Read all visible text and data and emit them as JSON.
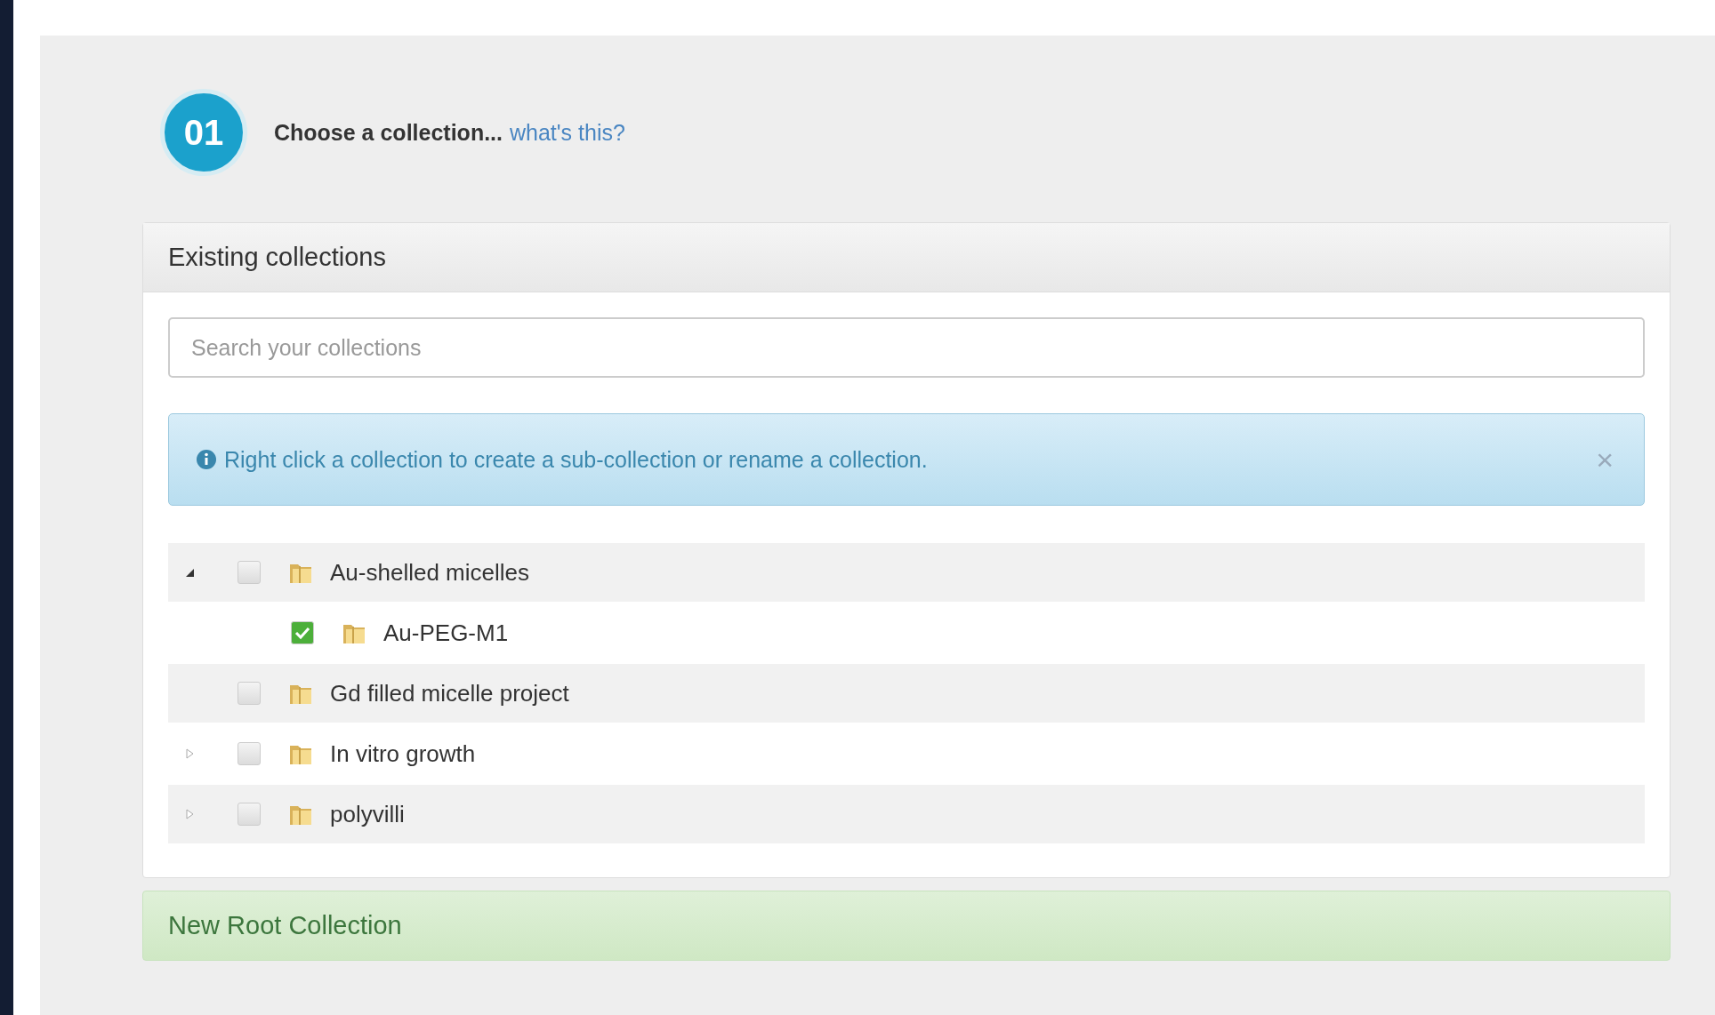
{
  "step": {
    "number": "01",
    "title": "Choose a collection...",
    "help_link": "what's this?"
  },
  "panel": {
    "title": "Existing collections",
    "search": {
      "placeholder": "Search your collections"
    },
    "alert": {
      "text": "Right click a collection to create a sub-collection or rename a collection.",
      "close": "×"
    },
    "tree": [
      {
        "name": "Au-shelled micelles",
        "checked": false,
        "expanded": true,
        "children": [
          {
            "name": "Au-PEG-M1",
            "checked": true
          }
        ]
      },
      {
        "name": "Gd filled micelle project",
        "checked": false
      },
      {
        "name": "In vitro growth",
        "checked": false,
        "expanded": false
      },
      {
        "name": "polyvilli",
        "checked": false,
        "expanded": false
      }
    ]
  },
  "new_root": {
    "label": "New Root Collection"
  }
}
